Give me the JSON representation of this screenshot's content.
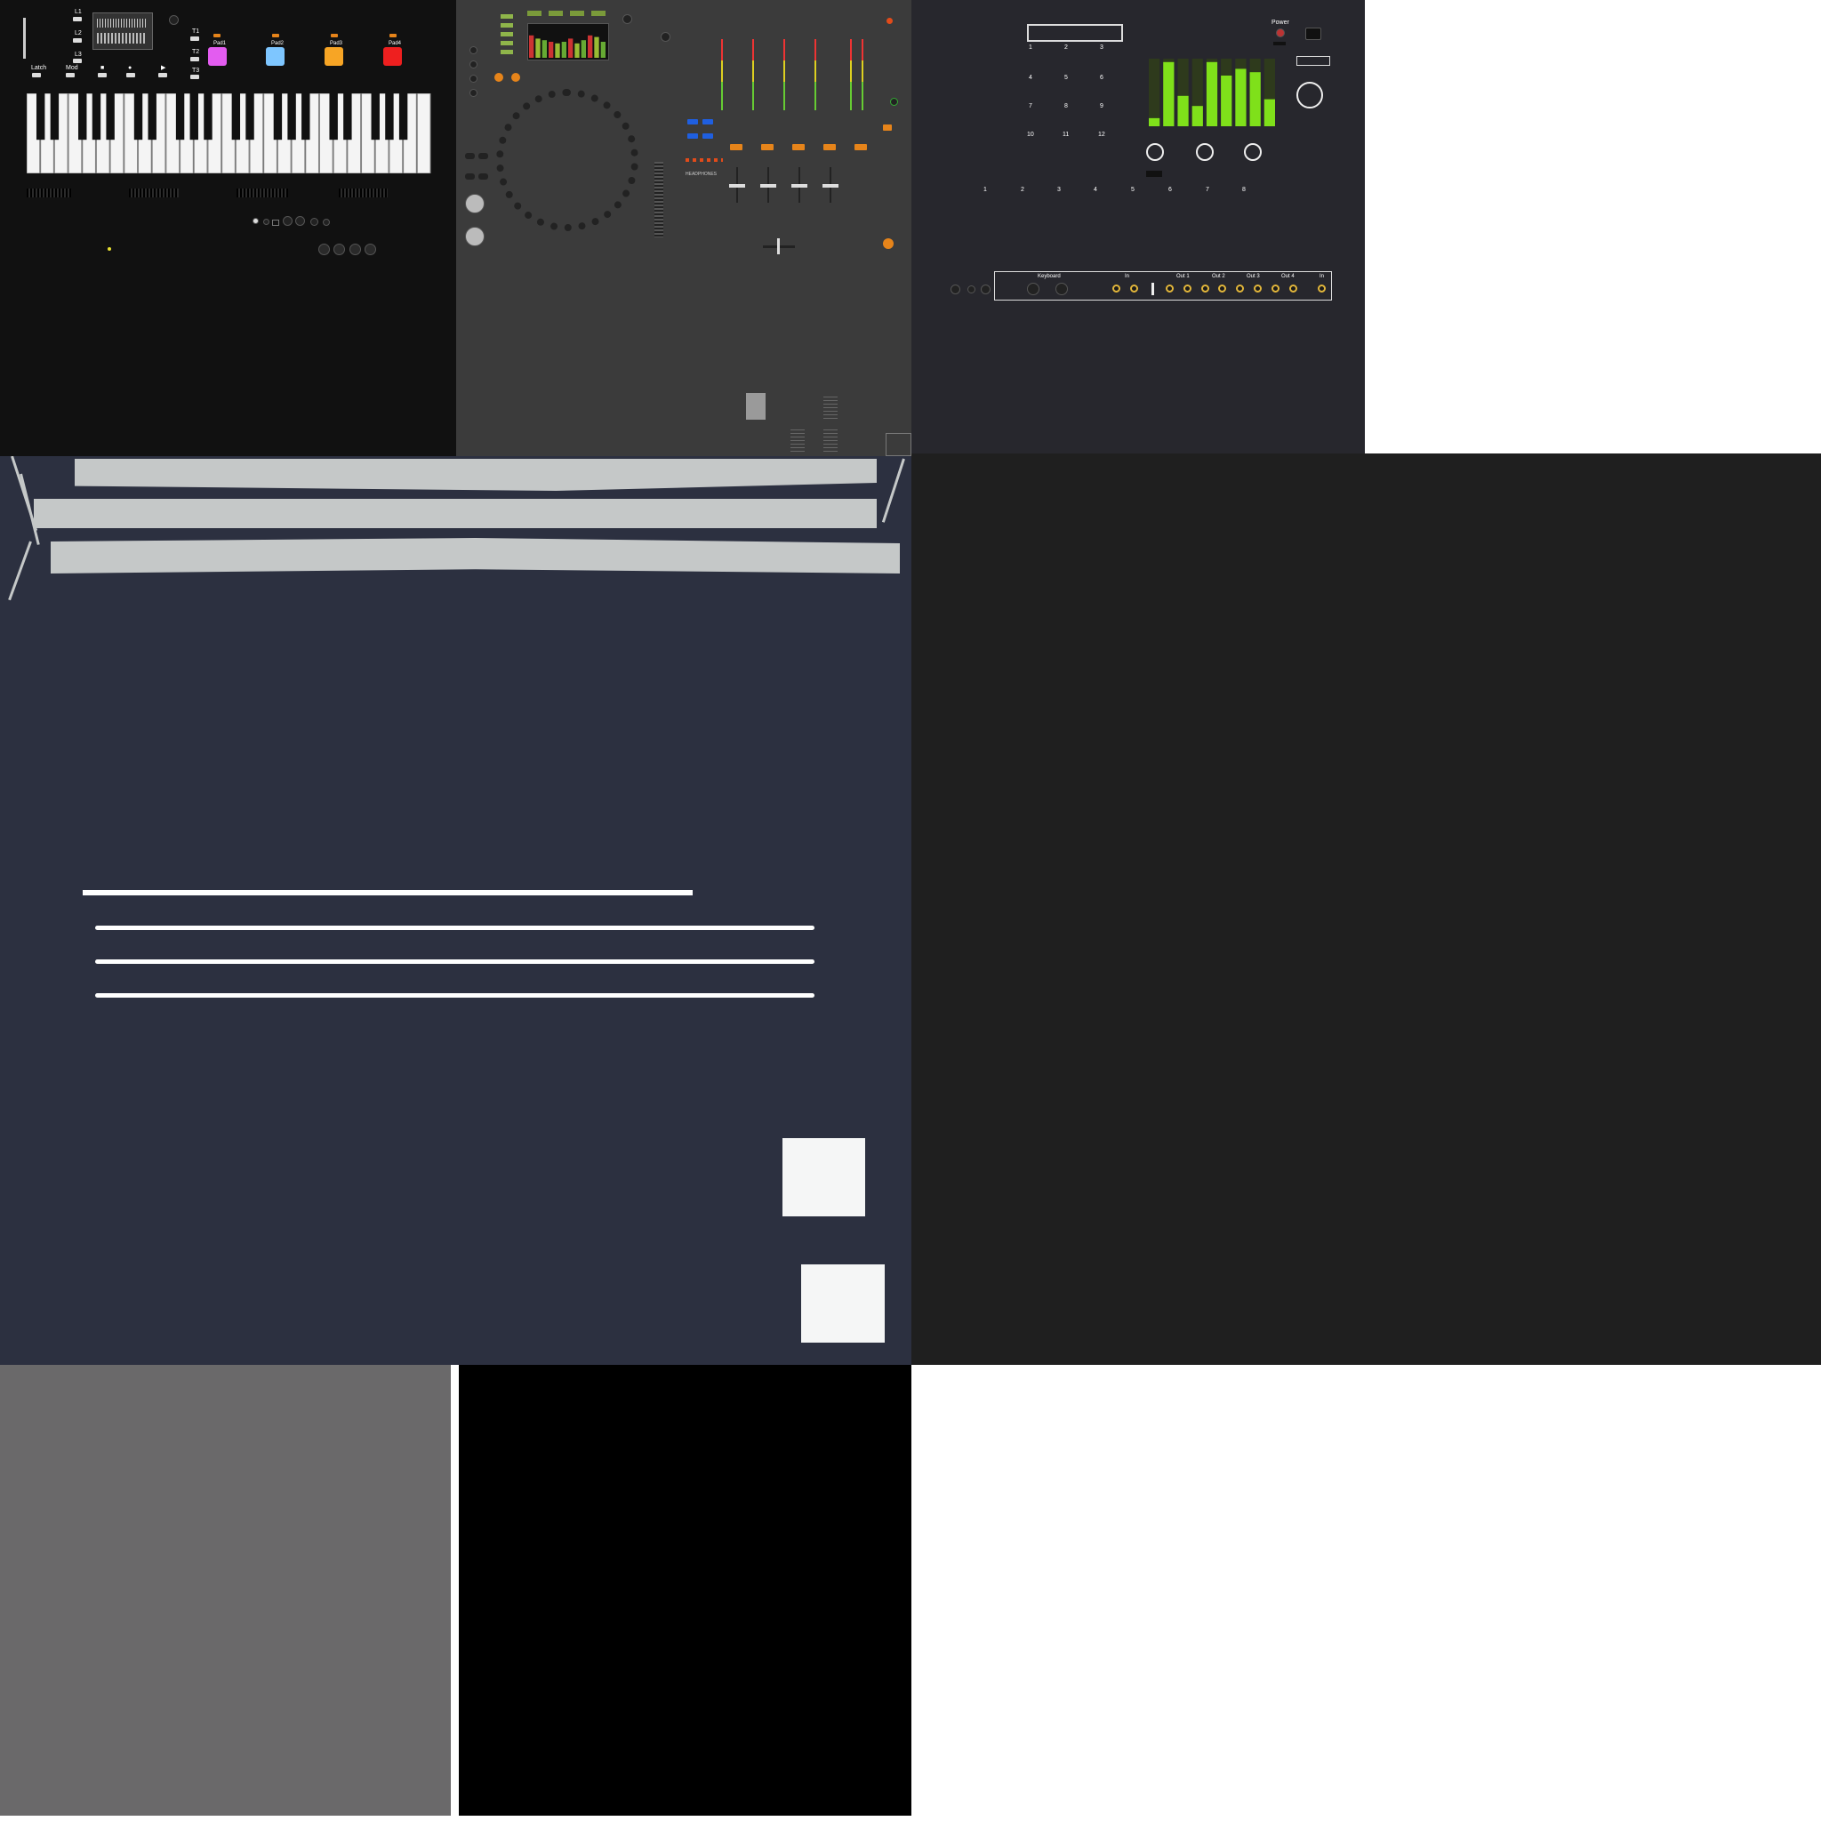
{
  "keyboard": {
    "layer_labels": [
      "L1",
      "L2",
      "L3"
    ],
    "mode_labels": [
      "Latch",
      "Mod"
    ],
    "track_labels": [
      "T1",
      "T2",
      "T3"
    ],
    "pads": [
      {
        "label": "Pad1",
        "color": "#e35cf0"
      },
      {
        "label": "Pad2",
        "color": "#7ec6ff"
      },
      {
        "label": "Pad3",
        "color": "#f7a525"
      },
      {
        "label": "Pad4",
        "color": "#ee1f1f"
      }
    ],
    "transport": [
      "■",
      "●",
      "▶"
    ]
  },
  "mixer": {
    "headphones_label": "HEADPHONES"
  },
  "module": {
    "top_grid_numbers": [
      "1",
      "2",
      "3",
      "4",
      "5",
      "6",
      "7",
      "8",
      "9",
      "10",
      "11",
      "12"
    ],
    "power_label": "Power",
    "bottom_numbers": [
      "1",
      "2",
      "3",
      "4",
      "5",
      "6",
      "7",
      "8"
    ],
    "io_labels": [
      "Keyboard",
      "In",
      "Out 1",
      "Out 2",
      "Out 3",
      "Out 4",
      "In"
    ],
    "colors": {
      "led": "#7fe01a",
      "jack": "#e2b63b"
    }
  },
  "colors": {
    "keyboard_bg": "#111111",
    "mixer_bg": "#3b3b3b",
    "module_bg": "#27272d",
    "navy": "#2c3040",
    "dark": "#1f1f1f",
    "gray": "#6a696a",
    "black": "#000000"
  }
}
